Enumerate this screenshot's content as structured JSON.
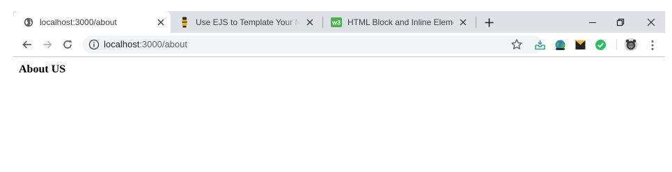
{
  "browser": {
    "tabs": [
      {
        "title": "localhost:3000/about",
        "favicon": "globe-icon",
        "active": true
      },
      {
        "title": "Use EJS to Template Your Node Application",
        "favicon": "ejs-icon",
        "active": false
      },
      {
        "title": "HTML Block and Inline Elements",
        "favicon": "w3schools-icon",
        "active": false
      }
    ],
    "new_tab_icon": "plus-icon",
    "window_controls": [
      "minimize-icon",
      "restore-icon",
      "close-icon"
    ],
    "toolbar": {
      "nav_icons": [
        "back-arrow-icon",
        "forward-arrow-icon",
        "reload-icon"
      ],
      "omnibox": {
        "icon": "info-icon",
        "host": "localhost",
        "path": ":3000/about",
        "bookmark_icon": "star-icon"
      },
      "extensions": [
        "inbox-extension-icon",
        "earth-extension-icon",
        "envelope-extension-icon",
        "checkmark-extension-icon"
      ],
      "profile_icon": "profile-avatar",
      "menu_icon": "kebab-menu-icon"
    },
    "colors": {
      "tabstrip": "#dee1e6",
      "omnibox": "#f1f3f4",
      "text": "#3c4043"
    }
  },
  "page": {
    "heading": "About US"
  }
}
